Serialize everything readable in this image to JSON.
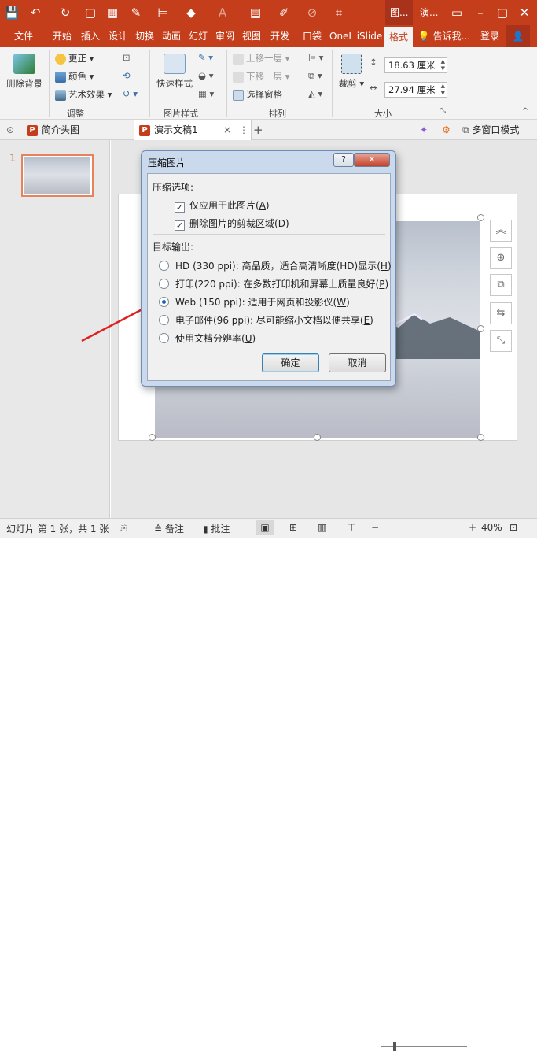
{
  "title_bar": {
    "contextual_tab_1": "图...",
    "contextual_tab_2": "演..."
  },
  "ribbon_tabs": [
    "文件",
    "开始",
    "插入",
    "设计",
    "切换",
    "动画",
    "幻灯",
    "审阅",
    "视图",
    "开发",
    "口袋",
    "OneI",
    "iSlide",
    "格式"
  ],
  "ribbon_tell_me": "告诉我...",
  "ribbon_login": "登录",
  "ribbon": {
    "remove_bg": "删除背景",
    "corrections": "更正",
    "color": "颜色",
    "artistic": "艺术效果",
    "group_adjust": "调整",
    "quick_styles": "快速样式",
    "group_picture_styles": "图片样式",
    "bring_forward": "上移一层",
    "send_backward": "下移一层",
    "selection_pane": "选择窗格",
    "group_arrange": "排列",
    "crop": "裁剪",
    "height_value": "18.63 厘米",
    "width_value": "27.94 厘米",
    "group_size": "大小"
  },
  "doc_tabs": {
    "tab1": "简介头图",
    "tab2": "演示文稿1",
    "close": "×",
    "add": "+",
    "multiwindow": "多窗口模式"
  },
  "thumbnail_number": "1",
  "dialog": {
    "title": "压缩图片",
    "help_btn": "?",
    "close_btn": "✕",
    "section_options": "压缩选项:",
    "opt_apply_only": "仅应用于此图片",
    "opt_apply_only_key": "A",
    "opt_delete_crop": "删除图片的剪裁区域",
    "opt_delete_crop_key": "D",
    "section_target": "目标输出:",
    "radio_hd": "HD (330 ppi): 高品质，适合高清晰度(HD)显示",
    "radio_hd_key": "H",
    "radio_print": "打印(220 ppi): 在多数打印机和屏幕上质量良好",
    "radio_print_key": "P",
    "radio_web": "Web (150 ppi): 适用于网页和投影仪",
    "radio_web_key": "W",
    "radio_email": "电子邮件(96 ppi): 尽可能缩小文档以便共享",
    "radio_email_key": "E",
    "radio_docres": "使用文档分辨率",
    "radio_docres_key": "U",
    "selected_option": "Web (150 ppi)",
    "ok": "确定",
    "cancel": "取消"
  },
  "status": {
    "slide_info": "幻灯片 第 1 张，共 1 张",
    "notes": "备注",
    "comments": "批注",
    "zoom": "40%"
  },
  "colors": {
    "accent": "#c43e1c",
    "arrow": "#e02020"
  }
}
